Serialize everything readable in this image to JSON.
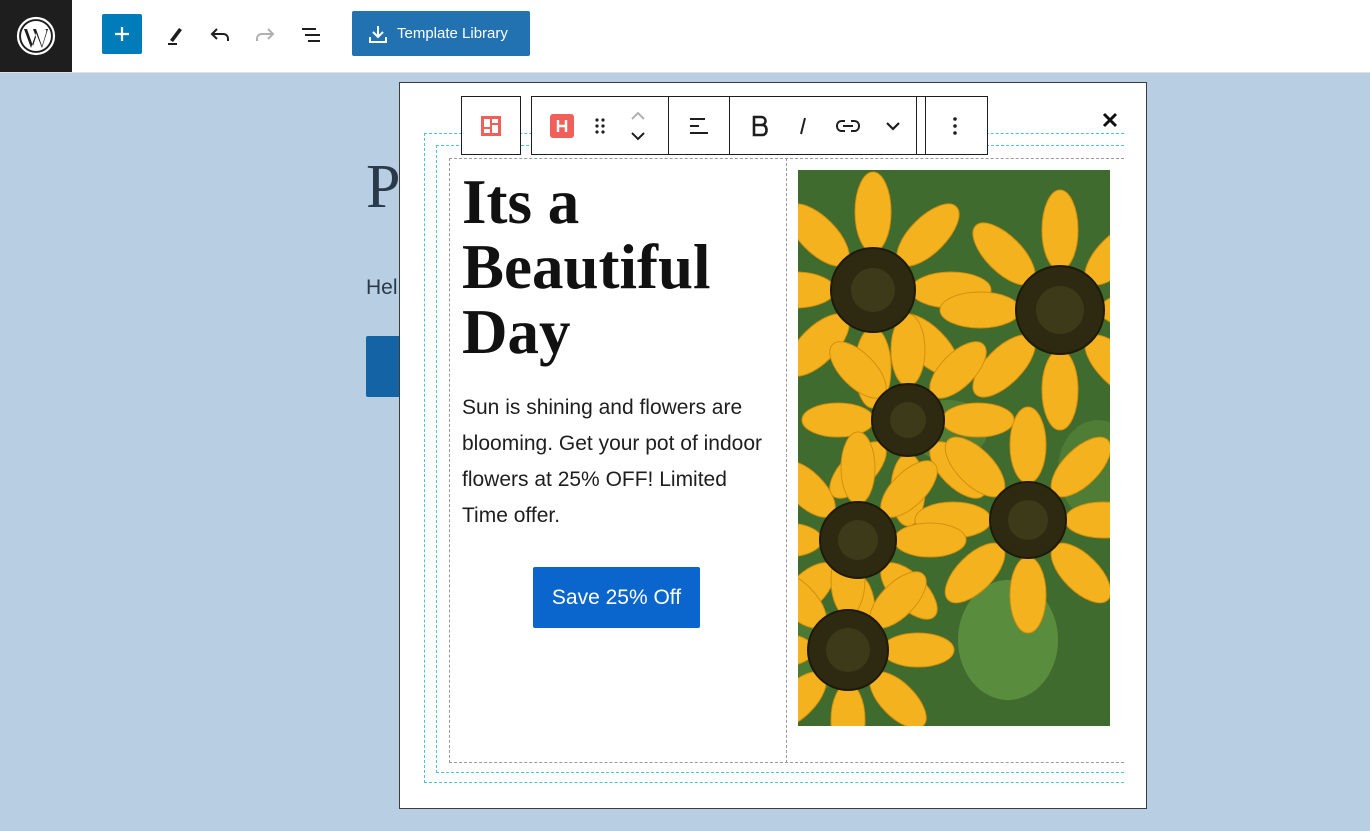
{
  "toolbar": {
    "template_library_label": "Template Library"
  },
  "background_post": {
    "title_fragment": "P",
    "paragraph_fragment": "Hel"
  },
  "modal": {
    "heading": "Its a Beautiful Day",
    "body": "Sun is shining and flowers are blooming. Get your pot of indoor flowers at 25% OFF! Limited Time offer.",
    "cta_label": "Save 25% Off",
    "image_subject": "sunflowers"
  },
  "colors": {
    "wp_admin_bar": "#1e1e1e",
    "primary_blue": "#007cba",
    "cta_blue": "#0a66cc",
    "canvas_bg": "#b8cfe3",
    "block_icon_red": "#f0605a"
  },
  "icons": {
    "block_toolbar": [
      "layout-block-icon",
      "heading-block-icon",
      "drag-handle-icon",
      "move-up-icon",
      "move-down-icon",
      "align-left-icon",
      "bold-icon",
      "italic-icon",
      "link-icon",
      "more-chevron-icon",
      "options-icon"
    ]
  }
}
